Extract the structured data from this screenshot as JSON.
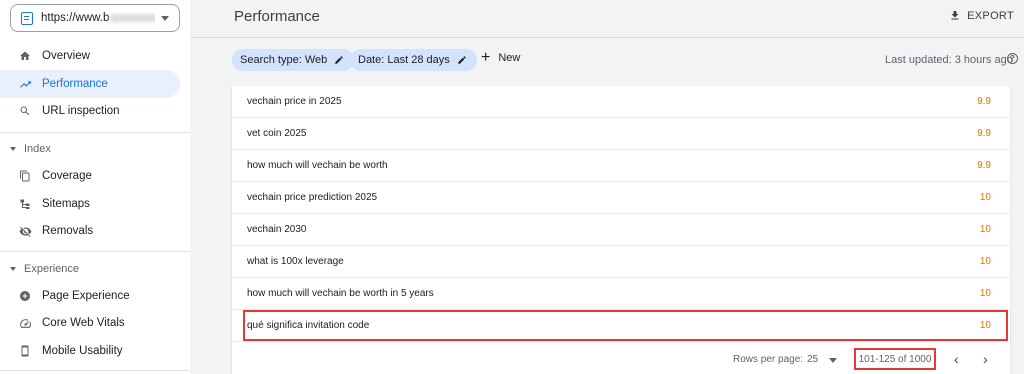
{
  "sidebar": {
    "property_url": "https://www.b",
    "property_url_suffix": "lpa...",
    "items": [
      {
        "label": "Overview",
        "icon": "home-icon"
      },
      {
        "label": "Performance",
        "icon": "trending-up-icon",
        "active": true
      },
      {
        "label": "URL inspection",
        "icon": "search-icon"
      }
    ],
    "index_section": {
      "label": "Index",
      "items": [
        {
          "label": "Coverage",
          "icon": "file-copy-icon"
        },
        {
          "label": "Sitemaps",
          "icon": "sitemap-icon"
        },
        {
          "label": "Removals",
          "icon": "visibility-off-icon"
        }
      ]
    },
    "experience_section": {
      "label": "Experience",
      "items": [
        {
          "label": "Page Experience",
          "icon": "add-circle-icon"
        },
        {
          "label": "Core Web Vitals",
          "icon": "speedometer-icon"
        },
        {
          "label": "Mobile Usability",
          "icon": "smartphone-icon"
        }
      ]
    }
  },
  "header": {
    "title": "Performance",
    "export_label": "EXPORT"
  },
  "filters": {
    "search_type": "Search type: Web",
    "date": "Date: Last 28 days",
    "new_label": "New",
    "last_updated": "Last updated: 3 hours ago"
  },
  "table": {
    "rows": [
      {
        "query": "vechain price in 2025",
        "position": "9.9"
      },
      {
        "query": "vet coin 2025",
        "position": "9.9"
      },
      {
        "query": "how much will vechain be worth",
        "position": "9.9"
      },
      {
        "query": "vechain price prediction 2025",
        "position": "10"
      },
      {
        "query": "vechain 2030",
        "position": "10"
      },
      {
        "query": "what is 100x leverage",
        "position": "10"
      },
      {
        "query": "how much will vechain be worth in 5 years",
        "position": "10"
      },
      {
        "query": "qué significa invitation code",
        "position": "10"
      }
    ]
  },
  "pager": {
    "rows_per_page_label": "Rows per page:",
    "rows_per_page": "25",
    "range": "101-125 of 1000",
    "prev": "‹",
    "next": "›"
  },
  "colors": {
    "accent": "#1a73e8",
    "chip_bg": "#d2e3fc",
    "position_text": "#e37400",
    "highlight": "#e53935"
  }
}
